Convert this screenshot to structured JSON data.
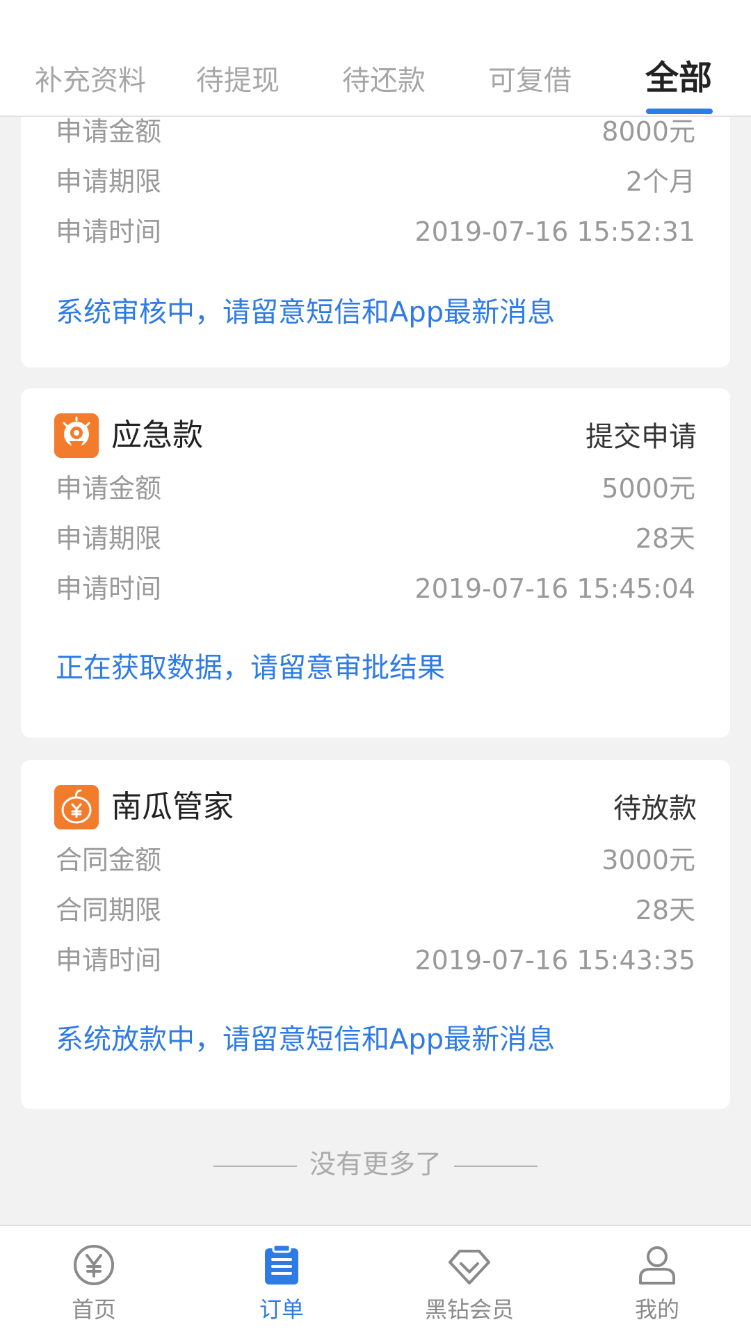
{
  "tabs": [
    {
      "label": "补充资料",
      "active": false
    },
    {
      "label": "待提现",
      "active": false
    },
    {
      "label": "待还款",
      "active": false
    },
    {
      "label": "可复借",
      "active": false
    },
    {
      "label": "全部",
      "active": true
    }
  ],
  "cards": [
    {
      "rows": [
        {
          "label": "申请金额",
          "value": "8000元"
        },
        {
          "label": "申请期限",
          "value": "2个月"
        },
        {
          "label": "申请时间",
          "value": "2019-07-16 15:52:31"
        }
      ],
      "note": "系统审核中，请留意短信和App最新消息"
    },
    {
      "name": "应急款",
      "icon": "lightbulb-coin-icon",
      "status": "提交申请",
      "rows": [
        {
          "label": "申请金额",
          "value": "5000元"
        },
        {
          "label": "申请期限",
          "value": "28天"
        },
        {
          "label": "申请时间",
          "value": "2019-07-16 15:45:04"
        }
      ],
      "note": "正在获取数据，请留意审批结果"
    },
    {
      "name": "南瓜管家",
      "icon": "pumpkin-yen-icon",
      "status": "待放款",
      "rows": [
        {
          "label": "合同金额",
          "value": "3000元"
        },
        {
          "label": "合同期限",
          "value": "28天"
        },
        {
          "label": "申请时间",
          "value": "2019-07-16 15:43:35"
        }
      ],
      "note": "系统放款中，请留意短信和App最新消息"
    }
  ],
  "end_text": "没有更多了",
  "nav": [
    {
      "label": "首页",
      "icon": "yen-coin-icon",
      "active": false
    },
    {
      "label": "订单",
      "icon": "clipboard-list-icon",
      "active": true
    },
    {
      "label": "黑钻会员",
      "icon": "diamond-icon",
      "active": false
    },
    {
      "label": "我的",
      "icon": "user-icon",
      "active": false
    }
  ],
  "colors": {
    "accent": "#2f7be5",
    "logo_orange": "#f27c2c",
    "background": "#f2f2f2"
  }
}
